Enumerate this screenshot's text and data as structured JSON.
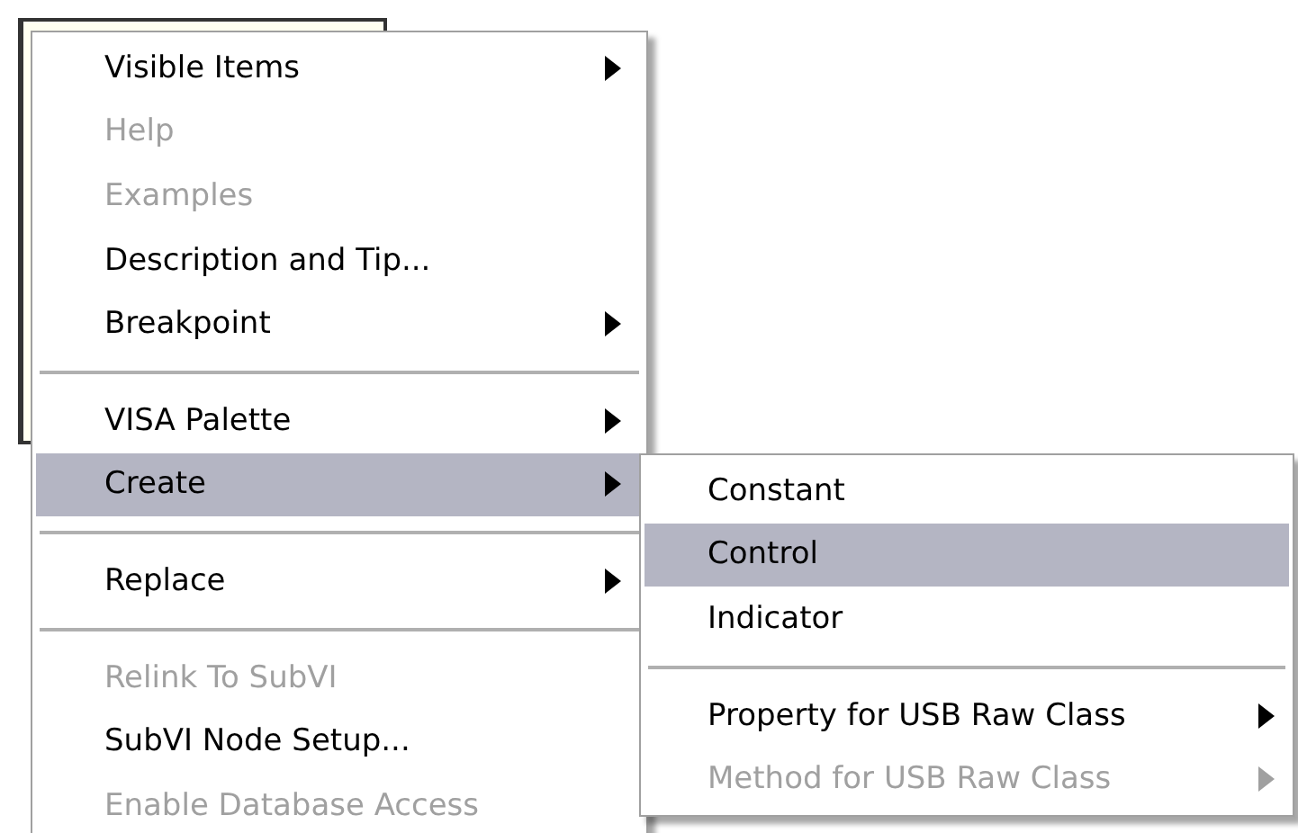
{
  "menu": {
    "items": [
      {
        "kind": "item",
        "label": "Visible Items",
        "disabled": false,
        "selected": false,
        "submenu": true
      },
      {
        "kind": "item",
        "label": "Help",
        "disabled": true,
        "selected": false,
        "submenu": false
      },
      {
        "kind": "item",
        "label": "Examples",
        "disabled": true,
        "selected": false,
        "submenu": false
      },
      {
        "kind": "item",
        "label": "Description and Tip...",
        "disabled": false,
        "selected": false,
        "submenu": false
      },
      {
        "kind": "item",
        "label": "Breakpoint",
        "disabled": false,
        "selected": false,
        "submenu": true
      },
      {
        "kind": "separator"
      },
      {
        "kind": "item",
        "label": "VISA Palette",
        "disabled": false,
        "selected": false,
        "submenu": true
      },
      {
        "kind": "item",
        "label": "Create",
        "disabled": false,
        "selected": true,
        "submenu": true
      },
      {
        "kind": "separator"
      },
      {
        "kind": "item",
        "label": "Replace",
        "disabled": false,
        "selected": false,
        "submenu": true
      },
      {
        "kind": "separator"
      },
      {
        "kind": "item",
        "label": "Relink To SubVI",
        "disabled": true,
        "selected": false,
        "submenu": false
      },
      {
        "kind": "item",
        "label": "SubVI Node Setup...",
        "disabled": false,
        "selected": false,
        "submenu": false
      },
      {
        "kind": "item",
        "label": "Enable Database Access",
        "disabled": true,
        "selected": false,
        "submenu": false
      }
    ]
  },
  "submenu": {
    "items": [
      {
        "kind": "item",
        "label": "Constant",
        "disabled": false,
        "selected": false,
        "submenu": false
      },
      {
        "kind": "item",
        "label": "Control",
        "disabled": false,
        "selected": true,
        "submenu": false
      },
      {
        "kind": "item",
        "label": "Indicator",
        "disabled": false,
        "selected": false,
        "submenu": false
      },
      {
        "kind": "separator"
      },
      {
        "kind": "item",
        "label": "Property for USB Raw Class",
        "disabled": false,
        "selected": false,
        "submenu": true
      },
      {
        "kind": "item",
        "label": "Method for USB Raw Class",
        "disabled": true,
        "selected": false,
        "submenu": true
      }
    ]
  }
}
